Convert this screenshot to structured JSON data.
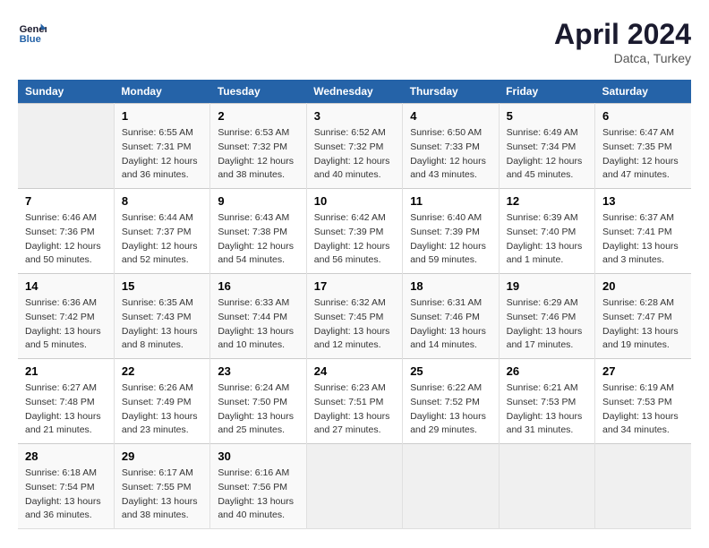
{
  "logo": {
    "line1": "General",
    "line2": "Blue"
  },
  "title": "April 2024",
  "location": "Datca, Turkey",
  "days_of_week": [
    "Sunday",
    "Monday",
    "Tuesday",
    "Wednesday",
    "Thursday",
    "Friday",
    "Saturday"
  ],
  "weeks": [
    [
      {
        "day": "",
        "info": ""
      },
      {
        "day": "1",
        "info": "Sunrise: 6:55 AM\nSunset: 7:31 PM\nDaylight: 12 hours\nand 36 minutes."
      },
      {
        "day": "2",
        "info": "Sunrise: 6:53 AM\nSunset: 7:32 PM\nDaylight: 12 hours\nand 38 minutes."
      },
      {
        "day": "3",
        "info": "Sunrise: 6:52 AM\nSunset: 7:32 PM\nDaylight: 12 hours\nand 40 minutes."
      },
      {
        "day": "4",
        "info": "Sunrise: 6:50 AM\nSunset: 7:33 PM\nDaylight: 12 hours\nand 43 minutes."
      },
      {
        "day": "5",
        "info": "Sunrise: 6:49 AM\nSunset: 7:34 PM\nDaylight: 12 hours\nand 45 minutes."
      },
      {
        "day": "6",
        "info": "Sunrise: 6:47 AM\nSunset: 7:35 PM\nDaylight: 12 hours\nand 47 minutes."
      }
    ],
    [
      {
        "day": "7",
        "info": "Sunrise: 6:46 AM\nSunset: 7:36 PM\nDaylight: 12 hours\nand 50 minutes."
      },
      {
        "day": "8",
        "info": "Sunrise: 6:44 AM\nSunset: 7:37 PM\nDaylight: 12 hours\nand 52 minutes."
      },
      {
        "day": "9",
        "info": "Sunrise: 6:43 AM\nSunset: 7:38 PM\nDaylight: 12 hours\nand 54 minutes."
      },
      {
        "day": "10",
        "info": "Sunrise: 6:42 AM\nSunset: 7:39 PM\nDaylight: 12 hours\nand 56 minutes."
      },
      {
        "day": "11",
        "info": "Sunrise: 6:40 AM\nSunset: 7:39 PM\nDaylight: 12 hours\nand 59 minutes."
      },
      {
        "day": "12",
        "info": "Sunrise: 6:39 AM\nSunset: 7:40 PM\nDaylight: 13 hours\nand 1 minute."
      },
      {
        "day": "13",
        "info": "Sunrise: 6:37 AM\nSunset: 7:41 PM\nDaylight: 13 hours\nand 3 minutes."
      }
    ],
    [
      {
        "day": "14",
        "info": "Sunrise: 6:36 AM\nSunset: 7:42 PM\nDaylight: 13 hours\nand 5 minutes."
      },
      {
        "day": "15",
        "info": "Sunrise: 6:35 AM\nSunset: 7:43 PM\nDaylight: 13 hours\nand 8 minutes."
      },
      {
        "day": "16",
        "info": "Sunrise: 6:33 AM\nSunset: 7:44 PM\nDaylight: 13 hours\nand 10 minutes."
      },
      {
        "day": "17",
        "info": "Sunrise: 6:32 AM\nSunset: 7:45 PM\nDaylight: 13 hours\nand 12 minutes."
      },
      {
        "day": "18",
        "info": "Sunrise: 6:31 AM\nSunset: 7:46 PM\nDaylight: 13 hours\nand 14 minutes."
      },
      {
        "day": "19",
        "info": "Sunrise: 6:29 AM\nSunset: 7:46 PM\nDaylight: 13 hours\nand 17 minutes."
      },
      {
        "day": "20",
        "info": "Sunrise: 6:28 AM\nSunset: 7:47 PM\nDaylight: 13 hours\nand 19 minutes."
      }
    ],
    [
      {
        "day": "21",
        "info": "Sunrise: 6:27 AM\nSunset: 7:48 PM\nDaylight: 13 hours\nand 21 minutes."
      },
      {
        "day": "22",
        "info": "Sunrise: 6:26 AM\nSunset: 7:49 PM\nDaylight: 13 hours\nand 23 minutes."
      },
      {
        "day": "23",
        "info": "Sunrise: 6:24 AM\nSunset: 7:50 PM\nDaylight: 13 hours\nand 25 minutes."
      },
      {
        "day": "24",
        "info": "Sunrise: 6:23 AM\nSunset: 7:51 PM\nDaylight: 13 hours\nand 27 minutes."
      },
      {
        "day": "25",
        "info": "Sunrise: 6:22 AM\nSunset: 7:52 PM\nDaylight: 13 hours\nand 29 minutes."
      },
      {
        "day": "26",
        "info": "Sunrise: 6:21 AM\nSunset: 7:53 PM\nDaylight: 13 hours\nand 31 minutes."
      },
      {
        "day": "27",
        "info": "Sunrise: 6:19 AM\nSunset: 7:53 PM\nDaylight: 13 hours\nand 34 minutes."
      }
    ],
    [
      {
        "day": "28",
        "info": "Sunrise: 6:18 AM\nSunset: 7:54 PM\nDaylight: 13 hours\nand 36 minutes."
      },
      {
        "day": "29",
        "info": "Sunrise: 6:17 AM\nSunset: 7:55 PM\nDaylight: 13 hours\nand 38 minutes."
      },
      {
        "day": "30",
        "info": "Sunrise: 6:16 AM\nSunset: 7:56 PM\nDaylight: 13 hours\nand 40 minutes."
      },
      {
        "day": "",
        "info": ""
      },
      {
        "day": "",
        "info": ""
      },
      {
        "day": "",
        "info": ""
      },
      {
        "day": "",
        "info": ""
      }
    ]
  ]
}
